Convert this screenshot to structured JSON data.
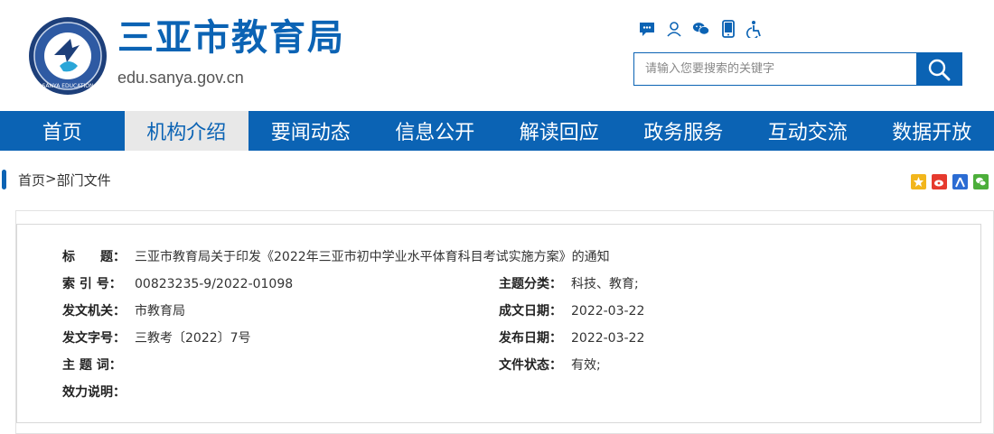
{
  "site": {
    "title": "三亚市教育局",
    "domain": "edu.sanya.gov.cn",
    "logo_text": "SANYA EDUCATION"
  },
  "toolbar": {
    "icons": [
      "chat-icon",
      "user-icon",
      "wechat-icon",
      "mobile-icon",
      "elder-mode-icon"
    ]
  },
  "search": {
    "placeholder": "请输入您要搜索的关键字"
  },
  "nav": {
    "items": [
      {
        "label": "首页",
        "active": false
      },
      {
        "label": "机构介绍",
        "active": true
      },
      {
        "label": "要闻动态",
        "active": false
      },
      {
        "label": "信息公开",
        "active": false
      },
      {
        "label": "解读回应",
        "active": false
      },
      {
        "label": "政务服务",
        "active": false
      },
      {
        "label": "互动交流",
        "active": false
      },
      {
        "label": "数据开放",
        "active": false
      }
    ]
  },
  "breadcrumb": {
    "home": "首页",
    "sep": ">",
    "current": "部门文件"
  },
  "share": {
    "icons": [
      "qzone-icon",
      "weibo-icon",
      "renren-icon",
      "wechat-share-icon"
    ],
    "colors": [
      "#f2b61c",
      "#e63a2e",
      "#2b6cd3",
      "#4cae3a"
    ]
  },
  "meta": {
    "title_label": "标　　题：",
    "title_value": "三亚市教育局关于印发《2022年三亚市初中学业水平体育科目考试实施方案》的通知",
    "index_label": "索 引 号：",
    "index_value": "00823235-9/2022-01098",
    "topic_label": "主题分类：",
    "topic_value": "科技、教育;",
    "issuer_label": "发文机关：",
    "issuer_value": "市教育局",
    "created_label": "成文日期：",
    "created_value": "2022-03-22",
    "docno_label": "发文字号：",
    "docno_value": "三教考〔2022〕7号",
    "published_label": "发布日期：",
    "published_value": "2022-03-22",
    "keywords_label": "主 题 词：",
    "keywords_value": "",
    "status_label": "文件状态：",
    "status_value": "有效;",
    "validity_label": "效力说明：",
    "validity_value": ""
  },
  "colors": {
    "brand": "#0b63b4",
    "nav_active_bg": "#e8e8e8"
  }
}
